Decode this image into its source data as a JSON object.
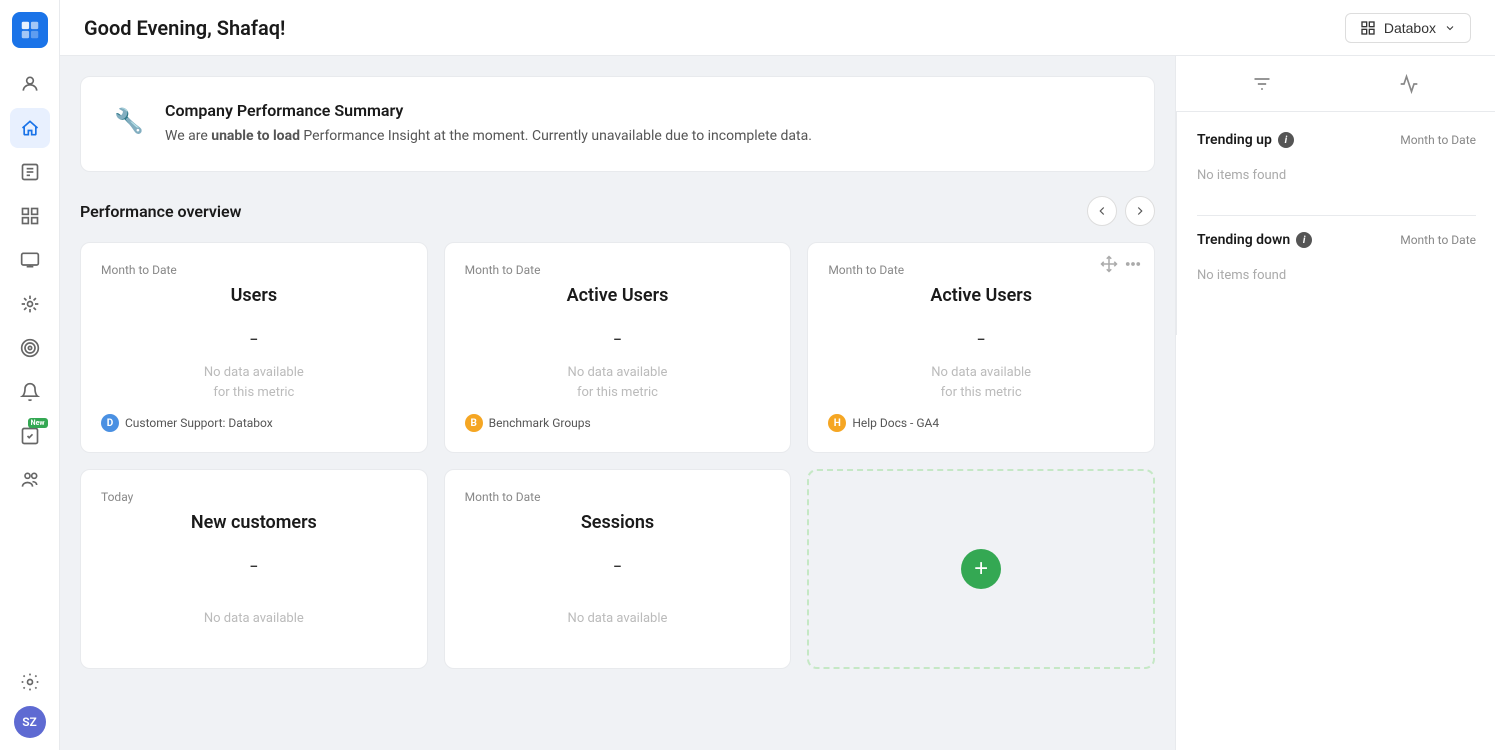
{
  "app": {
    "logo_label": "Databox Logo"
  },
  "topbar": {
    "greeting": "Good Evening, Shafaq!",
    "workspace_btn": "Databox",
    "workspace_icon": "📦"
  },
  "sidebar": {
    "items": [
      {
        "id": "people",
        "icon": "👤",
        "label": "People"
      },
      {
        "id": "home",
        "icon": "🏠",
        "label": "Home",
        "active": true
      },
      {
        "id": "numbers",
        "icon": "🔢",
        "label": "Numbers"
      },
      {
        "id": "chart",
        "icon": "📊",
        "label": "Chart"
      },
      {
        "id": "video",
        "icon": "▶",
        "label": "Video"
      },
      {
        "id": "stack",
        "icon": "🗂",
        "label": "Stack"
      },
      {
        "id": "target",
        "icon": "🎯",
        "label": "Target"
      },
      {
        "id": "notification",
        "icon": "🔔",
        "label": "Notifications"
      },
      {
        "id": "feedback",
        "icon": "😊",
        "label": "Feedback",
        "badge": "New"
      },
      {
        "id": "team",
        "icon": "👥",
        "label": "Team"
      }
    ],
    "bottom": [
      {
        "id": "settings",
        "icon": "⚙",
        "label": "Settings"
      },
      {
        "id": "avatar",
        "label": "SZ",
        "is_avatar": true
      }
    ]
  },
  "performance_summary": {
    "icon": "🔧",
    "title": "Company Performance Summary",
    "description_prefix": "We are ",
    "description_bold": "unable to load",
    "description_suffix": " Performance Insight at the moment. Currently unavailable due to incomplete data."
  },
  "performance_overview": {
    "title": "Performance overview",
    "nav_prev": "‹",
    "nav_next": "›",
    "cards": [
      {
        "id": "users",
        "period": "Month to Date",
        "title": "Users",
        "value": "-",
        "no_data_line1": "No data available",
        "no_data_line2": "for this metric",
        "source_icon": "D",
        "source_icon_type": "blue",
        "source_label": "Customer Support: Databox"
      },
      {
        "id": "active-users-1",
        "period": "Month to Date",
        "title": "Active Users",
        "value": "-",
        "no_data_line1": "No data available",
        "no_data_line2": "for this metric",
        "source_icon": "B",
        "source_icon_type": "orange",
        "source_label": "Benchmark Groups"
      },
      {
        "id": "active-users-2",
        "period": "Month to Date",
        "title": "Active Users",
        "value": "-",
        "no_data_line1": "No data available",
        "no_data_line2": "for this metric",
        "source_icon": "H",
        "source_icon_type": "orange",
        "source_label": "Help Docs - GA4",
        "has_actions": true
      },
      {
        "id": "new-customers",
        "period": "Today",
        "title": "New customers",
        "value": "-",
        "no_data_line1": "No data available",
        "no_data_line2": "",
        "source_icon": "",
        "source_label": ""
      },
      {
        "id": "sessions",
        "period": "Month to Date",
        "title": "Sessions",
        "value": "-",
        "no_data_line1": "No data available",
        "no_data_line2": "",
        "source_icon": "",
        "source_label": ""
      },
      {
        "id": "add-new",
        "is_add": true
      }
    ]
  },
  "right_panel": {
    "trending_up": {
      "label": "Trending up",
      "date": "Month to Date",
      "empty_text": "No items found"
    },
    "trending_down": {
      "label": "Trending down",
      "date": "Month to Date",
      "empty_text": "No items found"
    }
  }
}
